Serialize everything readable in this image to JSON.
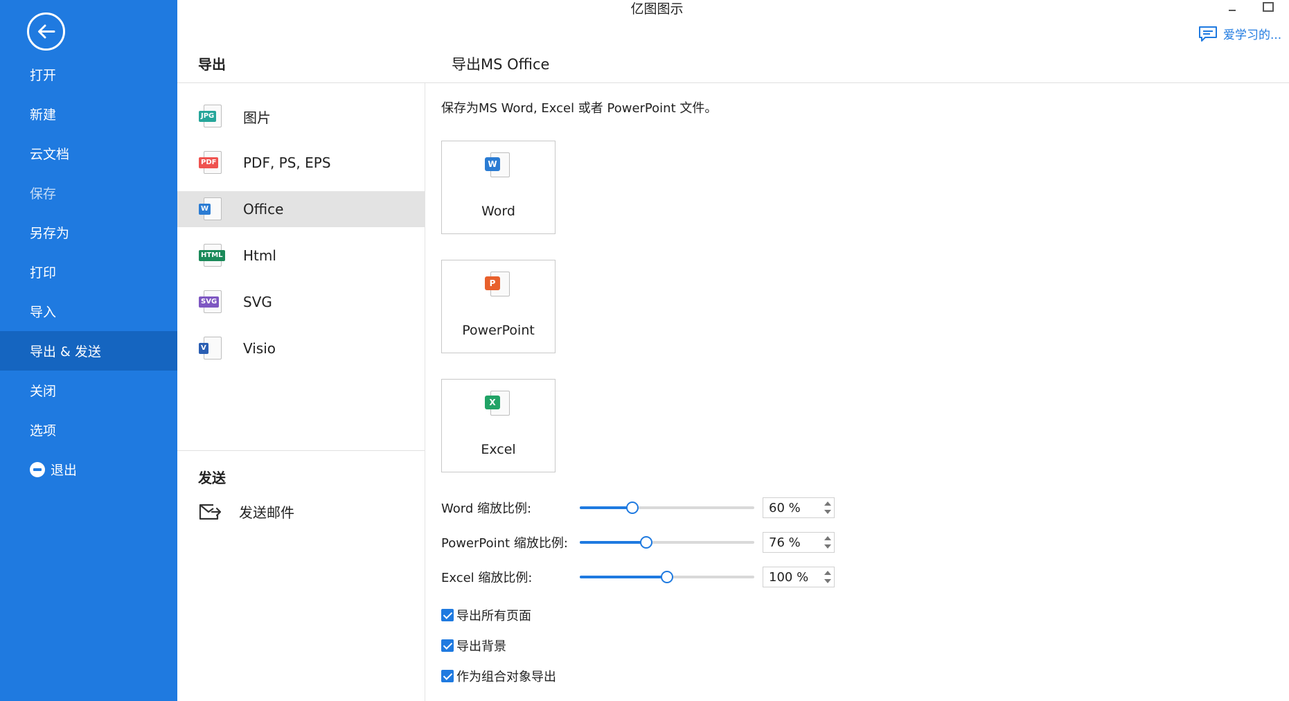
{
  "window": {
    "title": "亿图图示"
  },
  "help": {
    "label": "爱学习的..."
  },
  "sidebar": {
    "items": [
      {
        "label": "打开"
      },
      {
        "label": "新建"
      },
      {
        "label": "云文档"
      },
      {
        "label": "保存"
      },
      {
        "label": "另存为"
      },
      {
        "label": "打印"
      },
      {
        "label": "导入"
      },
      {
        "label": "导出 & 发送",
        "active": true
      },
      {
        "label": "关闭"
      },
      {
        "label": "选项"
      },
      {
        "label": "退出"
      }
    ]
  },
  "export": {
    "heading": "导出",
    "formats": [
      {
        "label": "图片",
        "badge": "JPG",
        "color": "#26a69a"
      },
      {
        "label": "PDF, PS, EPS",
        "badge": "PDF",
        "color": "#ef5350"
      },
      {
        "label": "Office",
        "badge": "W",
        "color": "#2b7cd3",
        "active": true
      },
      {
        "label": "Html",
        "badge": "HTML",
        "color": "#1b8a5a"
      },
      {
        "label": "SVG",
        "badge": "SVG",
        "color": "#7e57c2"
      },
      {
        "label": "Visio",
        "badge": "V",
        "color": "#2b5fb3"
      }
    ]
  },
  "send": {
    "heading": "发送",
    "email_label": "发送邮件"
  },
  "panel": {
    "title": "导出MS Office",
    "description": "保存为MS Word, Excel 或者 PowerPoint 文件。",
    "cards": [
      {
        "label": "Word",
        "badge": "W",
        "color": "#2b7cd3"
      },
      {
        "label": "PowerPoint",
        "badge": "P",
        "color": "#e8602c"
      },
      {
        "label": "Excel",
        "badge": "X",
        "color": "#21a366"
      }
    ],
    "zoom": [
      {
        "label": "Word 缩放比例:",
        "value": 60,
        "display": "60 %"
      },
      {
        "label": "PowerPoint 缩放比例:",
        "value": 76,
        "display": "76 %"
      },
      {
        "label": "Excel 缩放比例:",
        "value": 100,
        "display": "100 %"
      }
    ],
    "options": [
      {
        "label": "导出所有页面",
        "checked": true
      },
      {
        "label": "导出背景",
        "checked": true
      },
      {
        "label": "作为组合对象导出",
        "checked": true
      }
    ]
  },
  "colors": {
    "accent": "#1f7ae0",
    "sidebar_bg": "#1f7ae0",
    "sidebar_active": "#1565c0",
    "selected_row": "#e3e3e3"
  }
}
